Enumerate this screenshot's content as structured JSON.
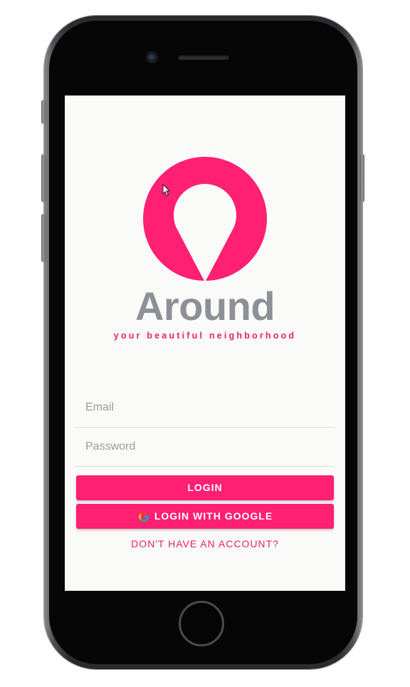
{
  "app": {
    "name": "Around",
    "tagline": "your beautiful neighborhood"
  },
  "form": {
    "email_placeholder": "Email",
    "password_placeholder": "Password",
    "login_label": "LOGIN",
    "google_login_label": "LOGIN WITH GOOGLE",
    "signup_link": "DON'T HAVE AN ACCOUNT?"
  },
  "colors": {
    "accent": "#ff1f73",
    "brand_text": "#8d9096",
    "background": "#fafaf8"
  },
  "icons": {
    "logo": "map-pin-logo",
    "google": "google-icon",
    "cursor": "mouse-cursor-icon"
  }
}
